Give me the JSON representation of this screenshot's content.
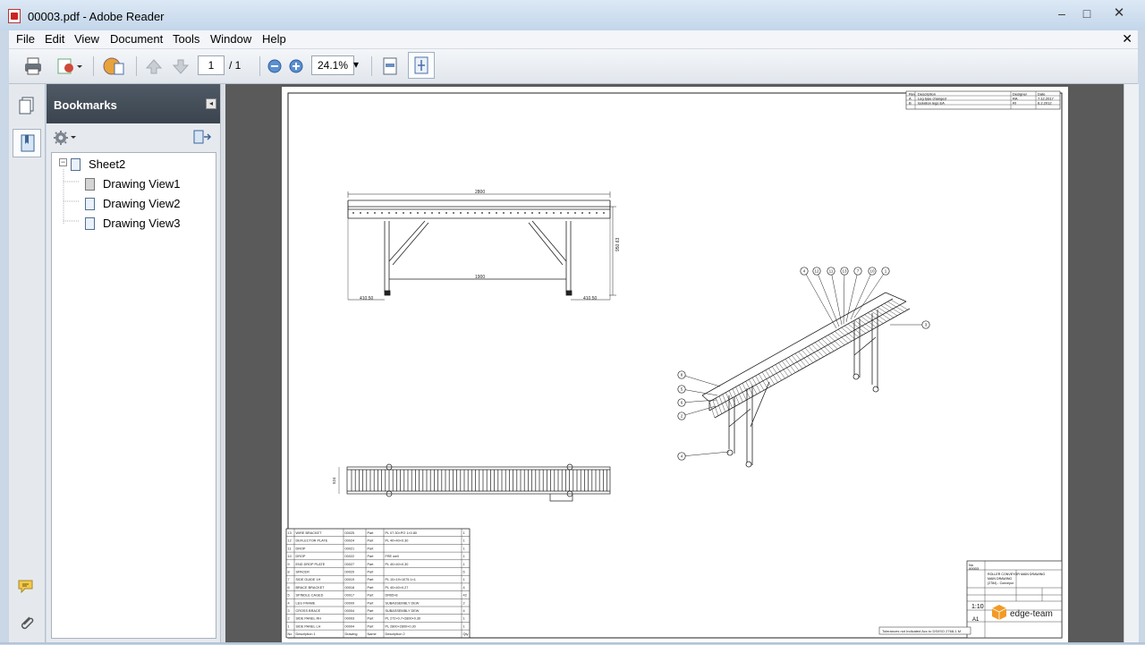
{
  "window": {
    "title": "00003.pdf - Adobe Reader",
    "minimize": "–",
    "maximize": "□",
    "close": "✕"
  },
  "menu": [
    "File",
    "Edit",
    "View",
    "Document",
    "Tools",
    "Window",
    "Help"
  ],
  "menu_close": "✕",
  "toolbar": {
    "page_current": "1",
    "page_total": "/ 1",
    "zoom": "24.1%",
    "zoom_arrow": "▾"
  },
  "bookmarks": {
    "title": "Bookmarks",
    "collapse": "◂",
    "tree": [
      {
        "label": "Sheet2",
        "expander": "−"
      },
      {
        "label": "Drawing View1"
      },
      {
        "label": "Drawing View2"
      },
      {
        "label": "Drawing View3"
      }
    ]
  },
  "drawing": {
    "dims": {
      "overall": "2800",
      "height": "950.63",
      "inner": "1900",
      "left": "410.50",
      "right": "410.50",
      "width": "524"
    },
    "balloons": [
      "4",
      "12",
      "11",
      "13",
      "7",
      "10",
      "1",
      "3",
      "8",
      "5",
      "6",
      "2",
      "4"
    ],
    "bom_rows": [
      [
        "13",
        "WIRE BRACKET",
        "00025",
        "Part",
        "PL 07.30×PO 1×0.80",
        "1"
      ],
      [
        "12",
        "DEFLECTOR PLATE",
        "00024",
        "Part",
        "PL 40×40×0.30",
        "1"
      ],
      [
        "11",
        "DROP",
        "00021",
        "Part",
        "",
        "1"
      ],
      [
        "10",
        "DROP",
        "00022",
        "Part",
        "FRE well",
        "1"
      ],
      [
        "9",
        "END DROP PLATE",
        "00027",
        "Part",
        "PL 40×40×0.30",
        "1"
      ],
      [
        "8",
        "SPACER",
        "00020",
        "Part",
        "",
        "6"
      ],
      [
        "7",
        "SIDE GUIDE 1H",
        "00019",
        "Part",
        "PL 10×19×1075.1×1",
        "1"
      ],
      [
        "6",
        "BRACE BRACKET",
        "00018",
        "Part",
        "PL 40×40×0.27",
        "4"
      ],
      [
        "5",
        "SPINDLE CAGED",
        "00017",
        "Part",
        "DR65×8",
        "42"
      ],
      [
        "4",
        "LEG FRAME",
        "00009",
        "Part",
        "SUBASSEMBLY DEW",
        "2"
      ],
      [
        "3",
        "CROSS BRACE",
        "00004",
        "Part",
        "SUBASSEMBLY DEW",
        "4"
      ],
      [
        "2",
        "SIDE PANEL RH",
        "00003",
        "Part",
        "PL 272×0.7×2800×0.30",
        "1"
      ],
      [
        "1",
        "SIDE PANEL LH",
        "00004",
        "Part",
        "PL 2800×2800×0.30",
        "1"
      ],
      [
        "No",
        "Description 1",
        "Drawing",
        "Name",
        "Description 2",
        "Qty"
      ]
    ],
    "rev_rows": [
      [
        "Rev",
        "Description",
        "Designer",
        "Date"
      ],
      [
        "A",
        "Leg type changed",
        "RA",
        "7.12.2017"
      ],
      [
        "B",
        "Isolation legs EA",
        "RI",
        "6.2.2012"
      ]
    ],
    "titleblock": {
      "drawing_no": "00003",
      "title_lines": [
        "ROLLER CONVEYOR MAIN DRAWING",
        "MAIN DRAWING",
        "(2784) - Conveyor"
      ],
      "scale": "1:10",
      "size": "A1",
      "logo": "edge-team",
      "tolerance": "Tolerances not Indicated Acc to DS/ISO 2768-1 M"
    }
  }
}
